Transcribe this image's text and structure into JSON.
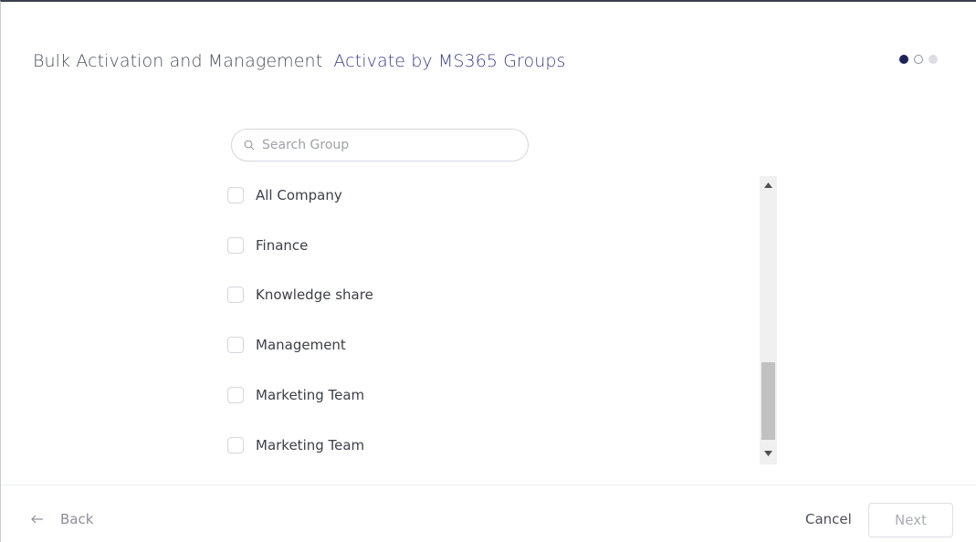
{
  "header": {
    "title": "Bulk Activation and Management",
    "subtitle": "Activate by MS365 Groups"
  },
  "steps": {
    "total": 3,
    "current": 1
  },
  "search": {
    "placeholder": "Search Group",
    "value": ""
  },
  "groups": [
    {
      "label": "All Company",
      "checked": false
    },
    {
      "label": "Finance",
      "checked": false
    },
    {
      "label": "Knowledge share",
      "checked": false
    },
    {
      "label": "Management",
      "checked": false
    },
    {
      "label": "Marketing Team",
      "checked": false
    },
    {
      "label": "Marketing Team",
      "checked": false
    }
  ],
  "footer": {
    "back_label": "Back",
    "cancel_label": "Cancel",
    "next_label": "Next"
  },
  "colors": {
    "accent": "#3b3e8f",
    "active_step": "#1d2358"
  }
}
